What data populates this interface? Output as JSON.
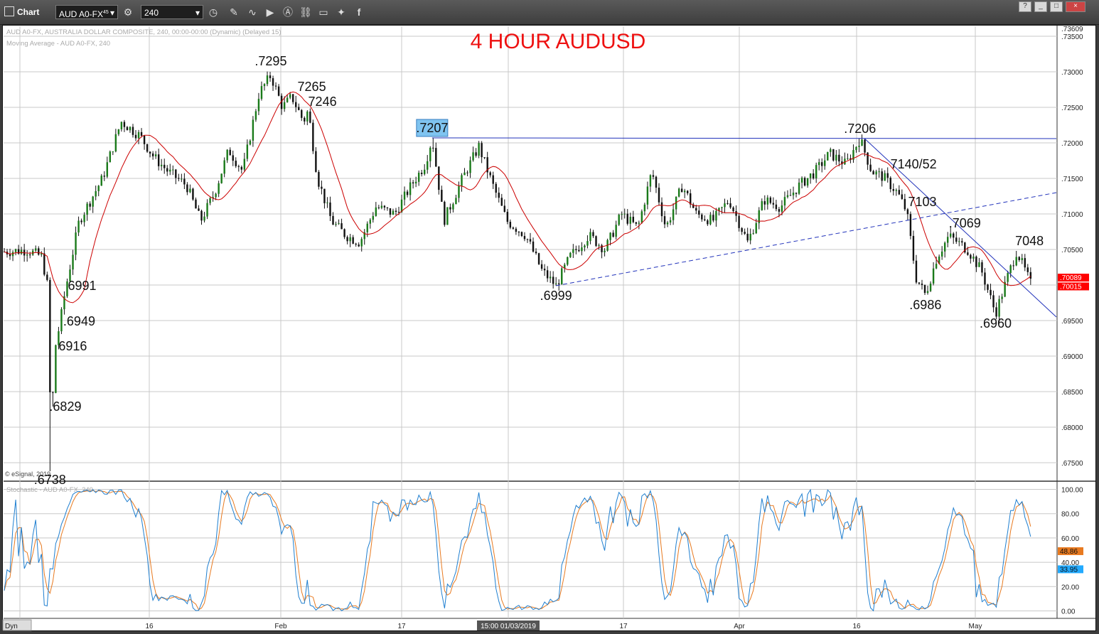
{
  "toolbar": {
    "title": "Chart",
    "symbol": "AUD A0-FX",
    "symbol_sup": "45",
    "interval": "240",
    "icons": [
      "settings-icon",
      "clock-icon",
      "pencil-icon",
      "curve-icon",
      "play-icon",
      "alert-icon",
      "link-icon",
      "comment-icon",
      "twitter-icon",
      "facebook-icon"
    ],
    "window_buttons": [
      "?",
      "_",
      "□",
      "×"
    ]
  },
  "chart_data": {
    "type": "candlestick",
    "title": "4 HOUR AUDUSD",
    "header_lines": [
      "AUD A0-FX, AUSTRALIA DOLLAR COMPOSITE, 240, 00:00-00:00 (Dynamic) (Delayed 15)",
      "Moving Average - AUD A0-FX, 240"
    ],
    "copyright": "© eSignal, 2019",
    "price_axis": {
      "ticks": [
        ".73500",
        ".73000",
        ".72500",
        ".72000",
        ".71500",
        ".71000",
        ".70500",
        ".70000",
        ".69500",
        ".69000",
        ".68500",
        ".68000",
        ".67500"
      ],
      "tick_values": [
        0.735,
        0.73,
        0.725,
        0.72,
        0.715,
        0.71,
        0.705,
        0.7,
        0.695,
        0.69,
        0.685,
        0.68,
        0.675
      ],
      "top_label": ".73609",
      "last_price_labels": [
        ".70089",
        ".70015"
      ],
      "range": [
        0.6725,
        0.7364
      ]
    },
    "time_axis": {
      "labels": [
        "16",
        "Feb",
        "17",
        "15:00 01/03/2019",
        "17",
        "Apr",
        "16",
        "May"
      ]
    },
    "annotations": [
      ".7295",
      "7265",
      "7246",
      ".7207",
      ".7206",
      "7140/52",
      "7103",
      ".7069",
      "7048",
      ".6999",
      ".6986",
      ".6960",
      "6991",
      ".6949",
      "6916",
      ".6829",
      ".6738"
    ],
    "price_path": [
      {
        "x": 0.0,
        "y": 0.7047
      },
      {
        "x": 1.0,
        "y": 0.7049
      },
      {
        "x": 1.6,
        "y": 0.704
      },
      {
        "x": 1.9,
        "y": 0.699
      },
      {
        "x": 2.0,
        "y": 0.6738
      },
      {
        "x": 2.05,
        "y": 0.6829
      },
      {
        "x": 2.2,
        "y": 0.6916
      },
      {
        "x": 2.4,
        "y": 0.6949
      },
      {
        "x": 2.6,
        "y": 0.6991
      },
      {
        "x": 3.2,
        "y": 0.709
      },
      {
        "x": 4.2,
        "y": 0.715
      },
      {
        "x": 5.0,
        "y": 0.723
      },
      {
        "x": 5.8,
        "y": 0.721
      },
      {
        "x": 6.4,
        "y": 0.718
      },
      {
        "x": 7.0,
        "y": 0.716
      },
      {
        "x": 7.8,
        "y": 0.714
      },
      {
        "x": 8.4,
        "y": 0.709
      },
      {
        "x": 9.0,
        "y": 0.713
      },
      {
        "x": 9.6,
        "y": 0.719
      },
      {
        "x": 10.2,
        "y": 0.716
      },
      {
        "x": 10.9,
        "y": 0.727
      },
      {
        "x": 11.4,
        "y": 0.7295
      },
      {
        "x": 11.9,
        "y": 0.725
      },
      {
        "x": 12.3,
        "y": 0.7265
      },
      {
        "x": 12.8,
        "y": 0.723
      },
      {
        "x": 13.0,
        "y": 0.7246
      },
      {
        "x": 13.4,
        "y": 0.715
      },
      {
        "x": 14.0,
        "y": 0.709
      },
      {
        "x": 14.6,
        "y": 0.707
      },
      {
        "x": 15.2,
        "y": 0.706
      },
      {
        "x": 15.9,
        "y": 0.711
      },
      {
        "x": 16.7,
        "y": 0.71
      },
      {
        "x": 17.4,
        "y": 0.714
      },
      {
        "x": 18.0,
        "y": 0.717
      },
      {
        "x": 18.3,
        "y": 0.7207
      },
      {
        "x": 18.8,
        "y": 0.709
      },
      {
        "x": 19.6,
        "y": 0.715
      },
      {
        "x": 20.3,
        "y": 0.7195
      },
      {
        "x": 20.9,
        "y": 0.714
      },
      {
        "x": 21.5,
        "y": 0.709
      },
      {
        "x": 22.3,
        "y": 0.707
      },
      {
        "x": 23.0,
        "y": 0.702
      },
      {
        "x": 23.6,
        "y": 0.6999
      },
      {
        "x": 24.2,
        "y": 0.704
      },
      {
        "x": 25.0,
        "y": 0.707
      },
      {
        "x": 25.7,
        "y": 0.705
      },
      {
        "x": 26.4,
        "y": 0.71
      },
      {
        "x": 27.1,
        "y": 0.708
      },
      {
        "x": 27.7,
        "y": 0.716
      },
      {
        "x": 28.3,
        "y": 0.708
      },
      {
        "x": 29.0,
        "y": 0.714
      },
      {
        "x": 29.6,
        "y": 0.71
      },
      {
        "x": 30.3,
        "y": 0.709
      },
      {
        "x": 31.0,
        "y": 0.712
      },
      {
        "x": 31.8,
        "y": 0.706
      },
      {
        "x": 32.5,
        "y": 0.712
      },
      {
        "x": 33.2,
        "y": 0.711
      },
      {
        "x": 34.0,
        "y": 0.714
      },
      {
        "x": 34.7,
        "y": 0.716
      },
      {
        "x": 35.3,
        "y": 0.7185
      },
      {
        "x": 36.0,
        "y": 0.717
      },
      {
        "x": 36.6,
        "y": 0.7206
      },
      {
        "x": 37.1,
        "y": 0.716
      },
      {
        "x": 37.6,
        "y": 0.7152
      },
      {
        "x": 38.2,
        "y": 0.713
      },
      {
        "x": 38.6,
        "y": 0.7103
      },
      {
        "x": 39.0,
        "y": 0.701
      },
      {
        "x": 39.4,
        "y": 0.6986
      },
      {
        "x": 39.9,
        "y": 0.704
      },
      {
        "x": 40.4,
        "y": 0.7069
      },
      {
        "x": 41.2,
        "y": 0.705
      },
      {
        "x": 41.8,
        "y": 0.702
      },
      {
        "x": 42.4,
        "y": 0.696
      },
      {
        "x": 42.9,
        "y": 0.701
      },
      {
        "x": 43.3,
        "y": 0.7048
      },
      {
        "x": 43.9,
        "y": 0.7002
      }
    ],
    "trendlines": [
      {
        "name": "horizontal resistance",
        "style": "solid",
        "from": {
          "x": 18.3,
          "y": 0.7207
        },
        "to": {
          "x": 45.0,
          "y": 0.7206
        }
      },
      {
        "name": "rising support",
        "style": "dashed",
        "from": {
          "x": 23.6,
          "y": 0.6999
        },
        "to": {
          "x": 45.0,
          "y": 0.713
        }
      },
      {
        "name": "falling resistance",
        "style": "solid",
        "from": {
          "x": 36.8,
          "y": 0.7206
        },
        "to": {
          "x": 45.0,
          "y": 0.6955
        }
      }
    ],
    "stochastic": {
      "label": "Stochastic - AUD A0-FX, 240",
      "ticks": [
        "100.00",
        "80.00",
        "60.00",
        "40.00",
        "20.00",
        "0.00"
      ],
      "tick_values": [
        100,
        80,
        60,
        40,
        20,
        0
      ],
      "last_values": [
        "48.86",
        "33.95"
      ],
      "range": [
        -5,
        105
      ]
    },
    "colors": {
      "up_candle": "#1a7a1a",
      "down_candle": "#111111",
      "moving_average": "#cc0000",
      "title": "#ee1111",
      "trendline": "#2233bb",
      "stoch_k": "#1f7fd0",
      "stoch_d": "#e87a20",
      "price_label": "#ff0000",
      "highlight": "#7fc4f0"
    }
  },
  "footer": {
    "dyn_label": "Dyn"
  }
}
